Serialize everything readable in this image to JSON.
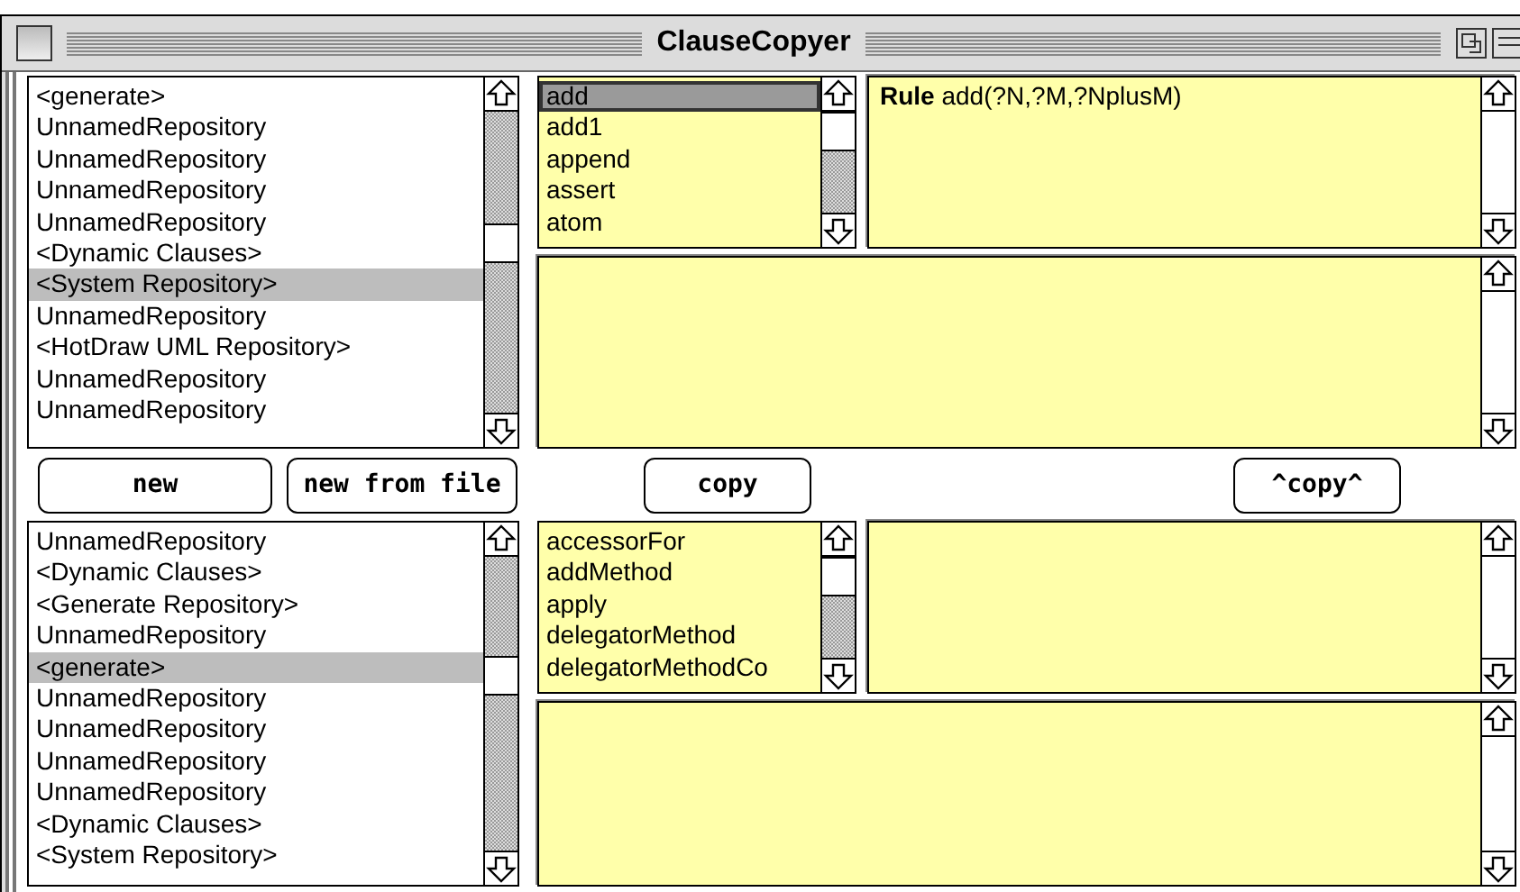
{
  "window": {
    "title": "ClauseCopyer"
  },
  "top": {
    "repositories": [
      {
        "label": "<generate>",
        "selected": false
      },
      {
        "label": "UnnamedRepository",
        "selected": false
      },
      {
        "label": "UnnamedRepository",
        "selected": false
      },
      {
        "label": "UnnamedRepository",
        "selected": false
      },
      {
        "label": "UnnamedRepository",
        "selected": false
      },
      {
        "label": "<Dynamic Clauses>",
        "selected": false
      },
      {
        "label": "<System Repository>",
        "selected": true
      },
      {
        "label": "UnnamedRepository",
        "selected": false
      },
      {
        "label": "<HotDraw UML Repository>",
        "selected": false
      },
      {
        "label": "UnnamedRepository",
        "selected": false
      },
      {
        "label": "UnnamedRepository",
        "selected": false
      }
    ],
    "clauses": [
      {
        "label": "add",
        "selected": true
      },
      {
        "label": "add1",
        "selected": false
      },
      {
        "label": "append",
        "selected": false
      },
      {
        "label": "assert",
        "selected": false
      },
      {
        "label": "atom",
        "selected": false
      }
    ],
    "rule": "**Rule** add(?N,?M,?NplusM)"
  },
  "buttons": [
    {
      "label": "new"
    },
    {
      "label": "new from file"
    },
    {
      "label": "copy"
    },
    {
      "label": "^copy^"
    }
  ],
  "bottom": {
    "repositories": [
      {
        "label": "UnnamedRepository",
        "selected": false
      },
      {
        "label": "<Dynamic Clauses>",
        "selected": false
      },
      {
        "label": "<Generate Repository>",
        "selected": false
      },
      {
        "label": "UnnamedRepository",
        "selected": false
      },
      {
        "label": "<generate>",
        "selected": true
      },
      {
        "label": "UnnamedRepository",
        "selected": false
      },
      {
        "label": "UnnamedRepository",
        "selected": false
      },
      {
        "label": "UnnamedRepository",
        "selected": false
      },
      {
        "label": "UnnamedRepository",
        "selected": false
      },
      {
        "label": "<Dynamic Clauses>",
        "selected": false
      },
      {
        "label": "<System Repository>",
        "selected": false
      }
    ],
    "clauses": [
      {
        "label": "accessorFor",
        "selected": false
      },
      {
        "label": "addMethod",
        "selected": false
      },
      {
        "label": "apply",
        "selected": false
      },
      {
        "label": "delegatorMethod",
        "selected": false
      },
      {
        "label": "delegatorMethodCo",
        "selected": false
      }
    ]
  }
}
